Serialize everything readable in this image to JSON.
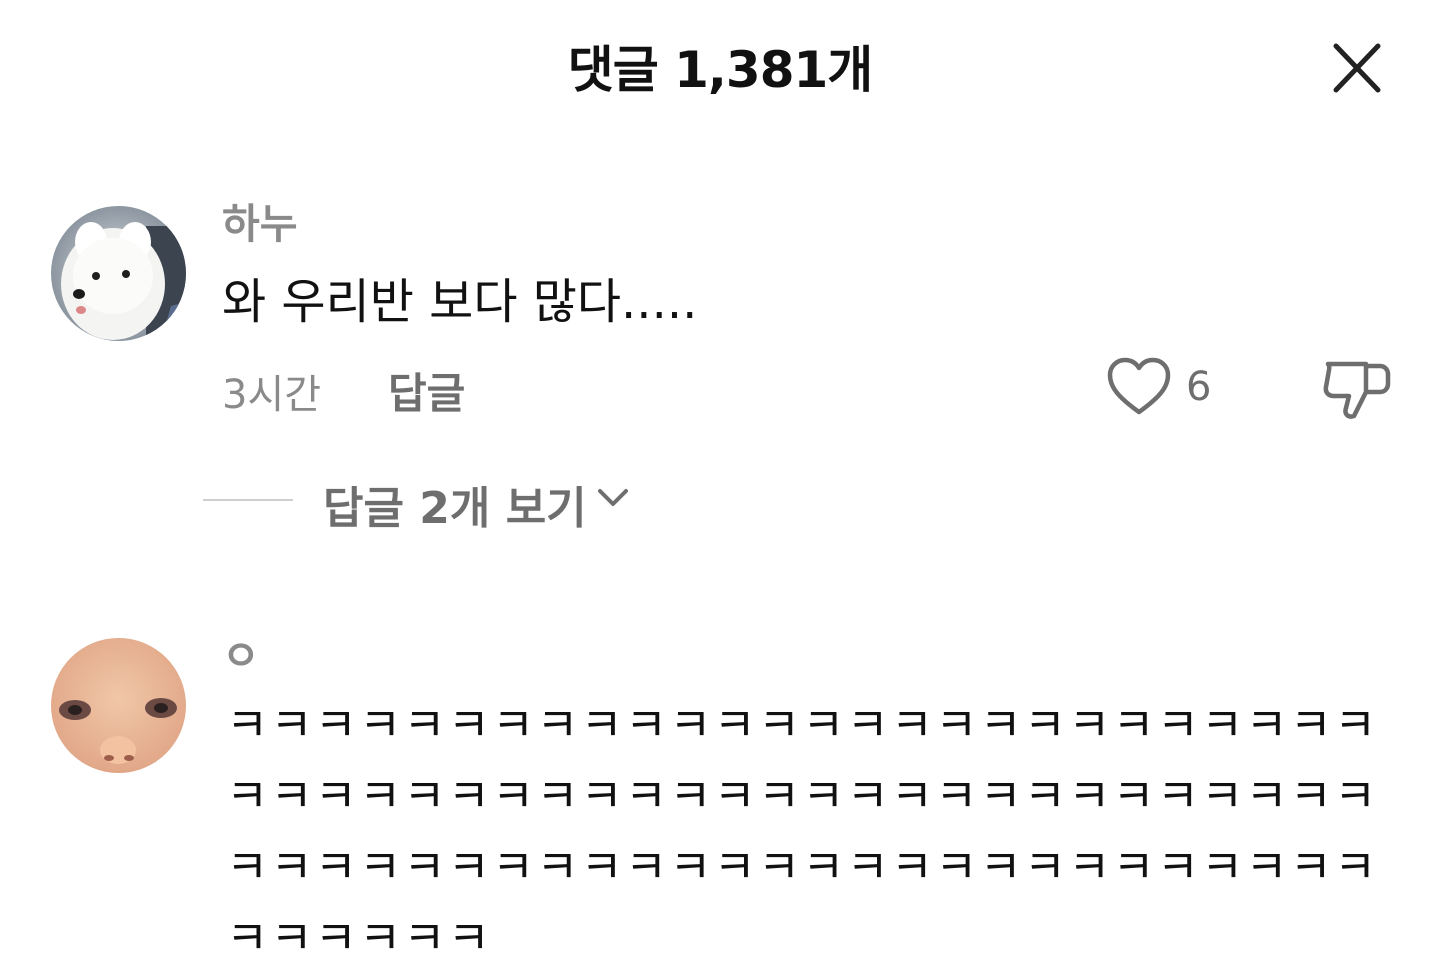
{
  "header": {
    "title": "댓글 1,381개"
  },
  "comments": [
    {
      "username": "하누",
      "text": "와 우리반 보다 많다.....",
      "time": "3시간",
      "reply_label": "답글",
      "like_count": "6",
      "view_replies_label": "답글 2개 보기"
    },
    {
      "username": "ㅇ",
      "text": "ㅋㅋㅋㅋㅋㅋㅋㅋㅋㅋㅋㅋㅋㅋㅋㅋㅋㅋㅋㅋㅋㅋㅋㅋㅋㅋㅋㅋㅋㅋㅋㅋㅋㅋㅋㅋㅋㅋㅋㅋㅋㅋㅋㅋㅋㅋㅋㅋㅋㅋㅋㅋㅋㅋㅋㅋㅋㅋㅋㅋㅋㅋㅋㅋㅋㅋㅋㅋㅋㅋㅋㅋㅋㅋㅋㅋㅋㅋㅋㅋㅋㅋㅋㅋ"
    }
  ],
  "icons": {
    "close": "close-icon",
    "like": "heart-icon",
    "dislike": "thumbs-down-icon",
    "expand": "chevron-down-icon"
  }
}
